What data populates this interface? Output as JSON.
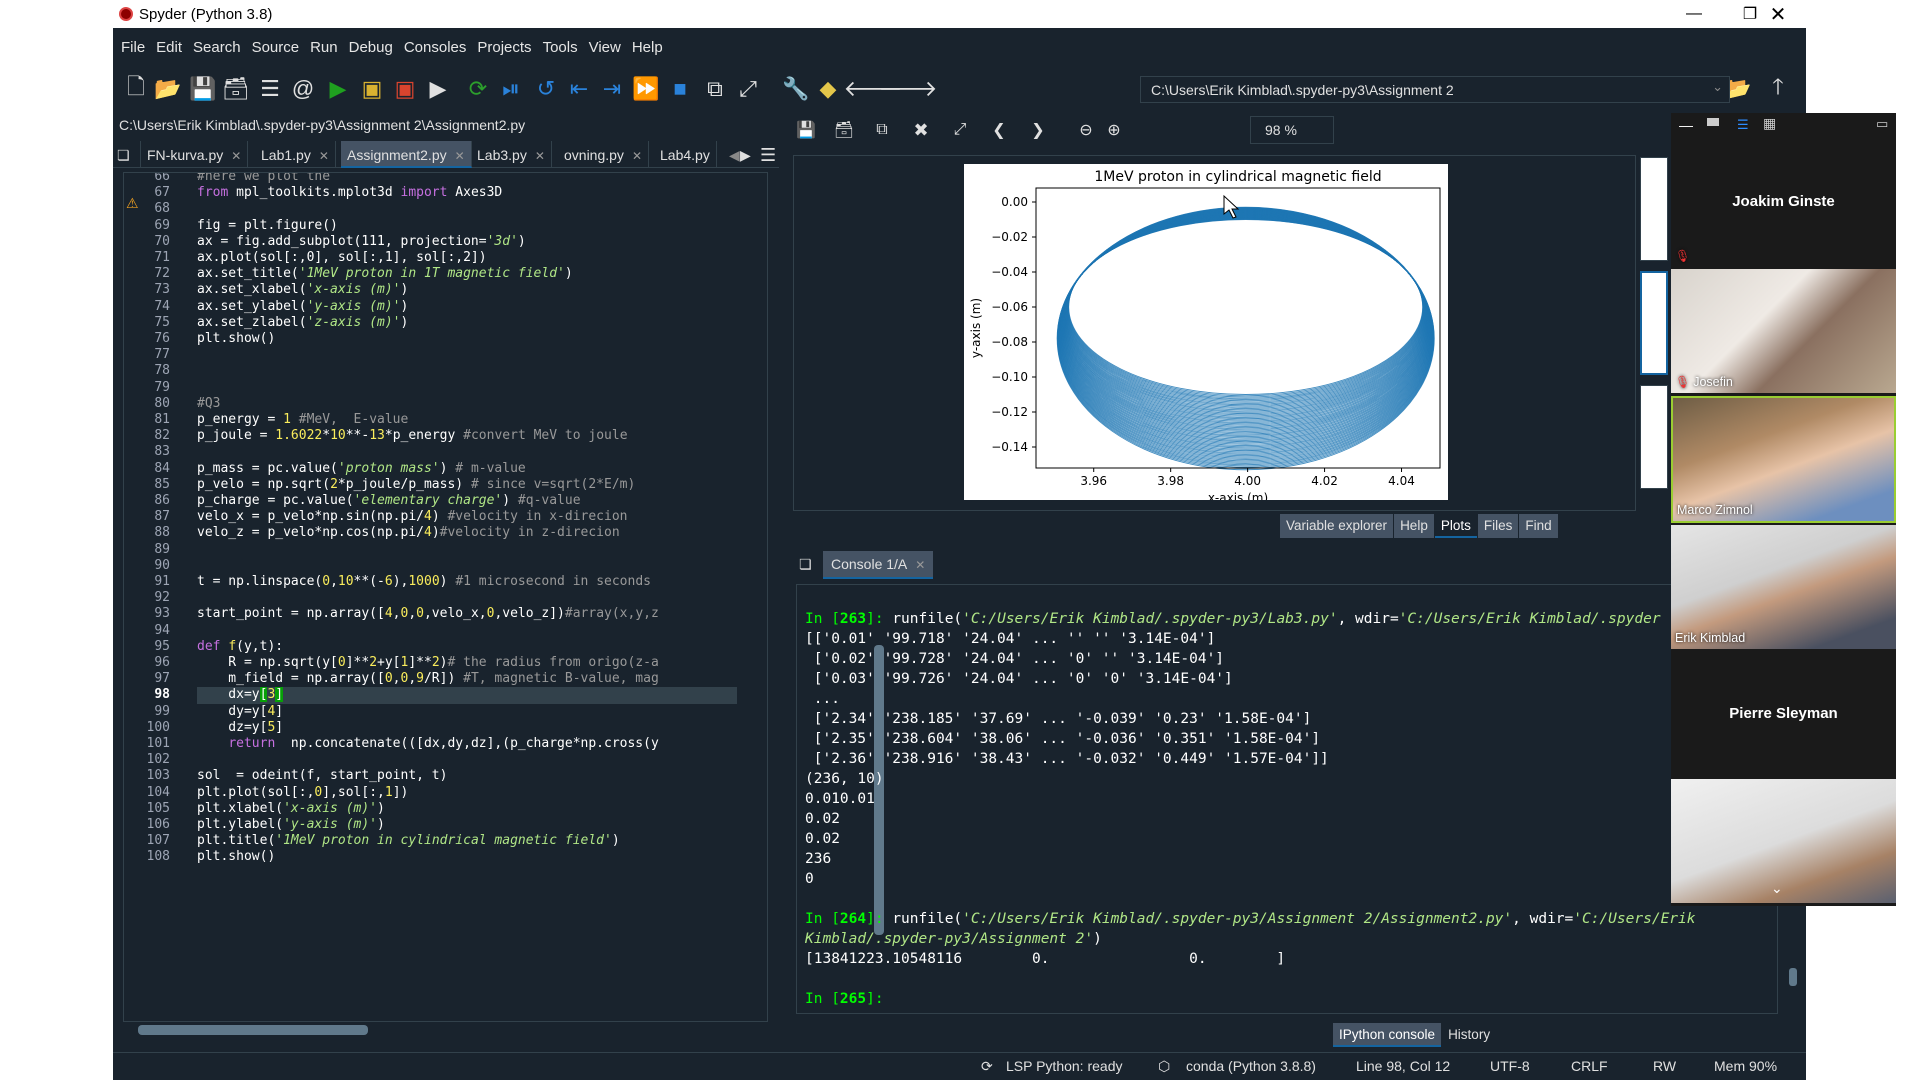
{
  "window": {
    "title": "Spyder (Python 3.8)"
  },
  "menu": [
    "File",
    "Edit",
    "Search",
    "Source",
    "Run",
    "Debug",
    "Consoles",
    "Projects",
    "Tools",
    "View",
    "Help"
  ],
  "toolbar": {
    "path": "C:\\Users\\Erik Kimblad\\.spyder-py3\\Assignment 2"
  },
  "editor": {
    "file_path": "C:\\Users\\Erik Kimblad\\.spyder-py3\\Assignment 2\\Assignment2.py",
    "tabs": [
      "FN-kurva.py",
      "Lab1.py",
      "Assignment2.py",
      "Lab3.py",
      "ovning.py",
      "Lab4.py"
    ],
    "line_numbers": [
      "66",
      "67",
      "68",
      "69",
      "70",
      "71",
      "72",
      "73",
      "74",
      "75",
      "76",
      "77",
      "78",
      "79",
      "80",
      "81",
      "82",
      "83",
      "84",
      "85",
      "86",
      "87",
      "88",
      "89",
      "90",
      "91",
      "92",
      "93",
      "94",
      "95",
      "96",
      "97",
      "98",
      "99",
      "100",
      "101",
      "102",
      "103",
      "104",
      "105",
      "106",
      "107",
      "108"
    ],
    "current_line": "98"
  },
  "plots": {
    "zoom": "98 %",
    "chart_title": "1MeV proton in cylindrical magnetic field",
    "xlabel": "x-axis (m)",
    "ylabel": "y-axis (m)",
    "tabs": [
      "Variable explorer",
      "Help",
      "Plots",
      "Files",
      "Find"
    ]
  },
  "chart_data": {
    "type": "line",
    "title": "1MeV proton in cylindrical magnetic field",
    "xlabel": "x-axis (m)",
    "ylabel": "y-axis (m)",
    "xlim": [
      3.945,
      4.05
    ],
    "ylim": [
      -0.152,
      0.008
    ],
    "xticks": [
      "3.96",
      "3.98",
      "4.00",
      "4.02",
      "4.04"
    ],
    "yticks": [
      "0.00",
      "−0.02",
      "−0.04",
      "−0.06",
      "−0.08",
      "−0.10",
      "−0.12",
      "−0.14"
    ],
    "series": [
      {
        "description": "helical trajectory projected to x-y, many overlapping ellipses",
        "center": [
          3.9995,
          -0.069
        ],
        "rx_range": [
          0.046,
          0.049
        ],
        "ry_range": [
          0.05,
          0.075
        ],
        "color": "#1f77b4"
      }
    ]
  },
  "console": {
    "tab": "Console 1/A",
    "tabs": [
      "IPython console",
      "History"
    ]
  },
  "status": {
    "lsp": "LSP Python: ready",
    "env": "conda (Python 3.8.8)",
    "pos": "Line 98, Col 12",
    "enc": "UTF-8",
    "eol": "CRLF",
    "perm": "RW",
    "mem": "Mem 90%"
  },
  "participants": [
    {
      "name": "Joakim Ginste",
      "video": false
    },
    {
      "name": "Josefin",
      "video": true
    },
    {
      "name": "Marco Zimnol",
      "video": true
    },
    {
      "name": "Erik Kimblad",
      "video": true
    },
    {
      "name": "Pierre Sleyman",
      "video": false
    },
    {
      "name": "",
      "video": true
    }
  ],
  "colors": {
    "ide_bg": "#19232d",
    "accent": "#1464a0",
    "plot_line": "#1f77b4"
  }
}
